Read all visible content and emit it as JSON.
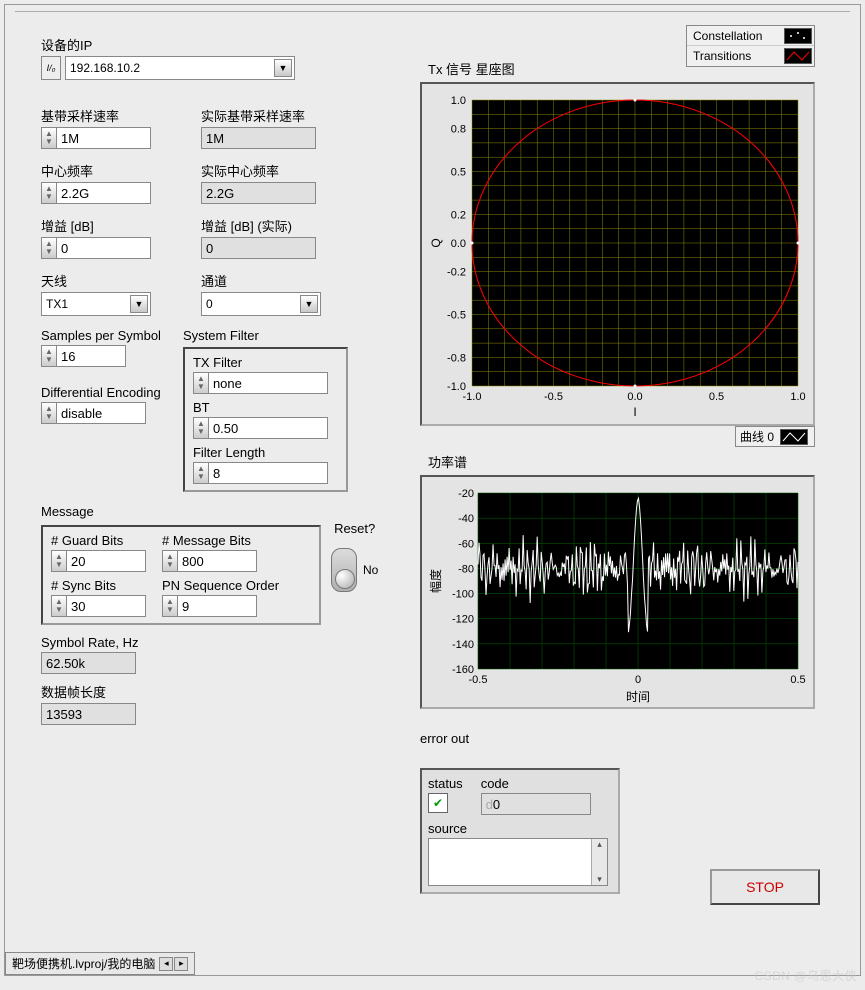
{
  "left": {
    "ip": {
      "label": "设备的IP",
      "value": "192.168.10.2"
    },
    "baseband_rate": {
      "label": "基带采样速率",
      "value": "1M"
    },
    "baseband_rate_actual": {
      "label": "实际基带采样速率",
      "value": "1M"
    },
    "center_freq": {
      "label": "中心频率",
      "value": "2.2G"
    },
    "center_freq_actual": {
      "label": "实际中心频率",
      "value": "2.2G"
    },
    "gain": {
      "label": "增益 [dB]",
      "value": "0"
    },
    "gain_actual": {
      "label": "增益 [dB] (实际)",
      "value": "0"
    },
    "antenna": {
      "label": "天线",
      "value": "TX1"
    },
    "channel": {
      "label": "通道",
      "value": "0"
    },
    "sps": {
      "label": "Samples per Symbol",
      "value": "16"
    },
    "system_filter": {
      "label": "System Filter",
      "tx_filter": {
        "label": "TX Filter",
        "value": "none"
      },
      "bt": {
        "label": "BT",
        "value": "0.50"
      },
      "filter_length": {
        "label": "Filter Length",
        "value": "8"
      }
    },
    "diff_enc": {
      "label": "Differential Encoding",
      "value": "disable"
    },
    "message": {
      "label": "Message",
      "guard_bits": {
        "label": "# Guard Bits",
        "value": "20"
      },
      "message_bits": {
        "label": "# Message Bits",
        "value": "800"
      },
      "sync_bits": {
        "label": "# Sync Bits",
        "value": "30"
      },
      "pn_order": {
        "label": "PN Sequence Order",
        "value": "9"
      }
    },
    "reset": {
      "label": "Reset?",
      "value": "No"
    },
    "symbol_rate": {
      "label": "Symbol Rate, Hz",
      "value": "62.50k"
    },
    "frame_len": {
      "label": "数据帧长度",
      "value": "13593"
    }
  },
  "right": {
    "const_legend": {
      "constellation": "Constellation",
      "transitions": "Transitions"
    },
    "const_title": "Tx 信号 星座图",
    "const_xlabel": "I",
    "const_ylabel": "Q",
    "power_title": "功率谱",
    "power_legend_label": "曲线 0",
    "power_xlabel": "时间",
    "power_ylabel": "幅度",
    "error": {
      "label": "error out",
      "status": "status",
      "code_label": "code",
      "code": "0",
      "source_label": "source",
      "source": ""
    },
    "stop": "STOP"
  },
  "footer": "靶场便携机.lvproj/我的电脑",
  "watermark": "CSDN @乌恩大侠",
  "chart_data": [
    {
      "type": "scatter",
      "title": "Tx 信号 星座图",
      "xlabel": "I",
      "ylabel": "Q",
      "xlim": [
        -1.0,
        1.0
      ],
      "ylim": [
        -1.0,
        1.0
      ],
      "grid": true,
      "series": [
        {
          "name": "Constellation",
          "style": "points",
          "color": "#ffffff",
          "x": [
            1.0,
            0.0,
            -1.0,
            0.0
          ],
          "y": [
            0.0,
            1.0,
            0.0,
            -1.0
          ]
        },
        {
          "name": "Transitions",
          "style": "line",
          "color": "#ff0000",
          "path": "unit_circle"
        }
      ]
    },
    {
      "type": "line",
      "title": "功率谱",
      "xlabel": "时间",
      "ylabel": "幅度",
      "xlim": [
        -0.5,
        0.5
      ],
      "ylim": [
        -160,
        -20
      ],
      "grid": true,
      "series": [
        {
          "name": "曲线 0",
          "color": "#ffffff",
          "x": [
            -0.5,
            -0.45,
            -0.4,
            -0.35,
            -0.3,
            -0.25,
            -0.2,
            -0.15,
            -0.1,
            -0.05,
            0.0,
            0.05,
            0.1,
            0.15,
            0.2,
            0.25,
            0.3,
            0.35,
            0.4,
            0.45,
            0.5
          ],
          "y": [
            -80,
            -85,
            -78,
            -90,
            -80,
            -82,
            -75,
            -80,
            -70,
            -55,
            -25,
            -55,
            -70,
            -80,
            -75,
            -82,
            -80,
            -90,
            -78,
            -85,
            -80
          ]
        }
      ]
    }
  ]
}
